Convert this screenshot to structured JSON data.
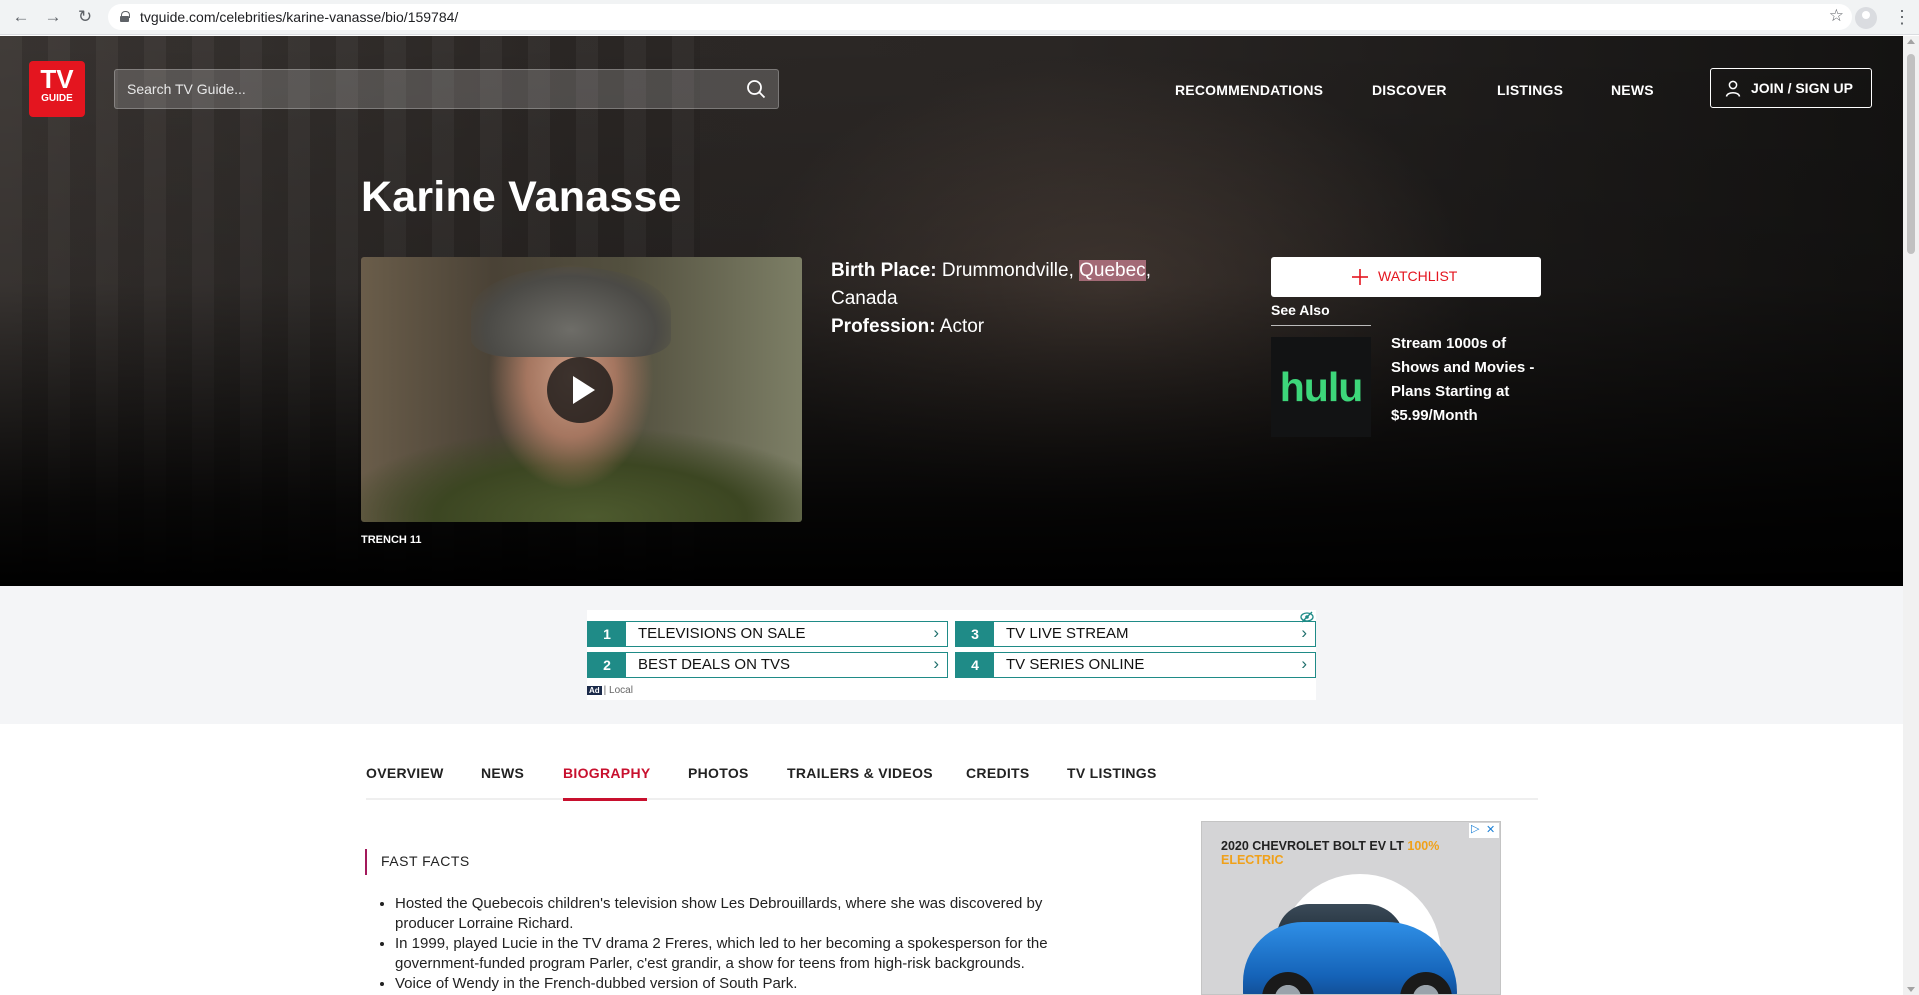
{
  "browser": {
    "url": "tvguide.com/celebrities/karine-vanasse/bio/159784/",
    "back_icon": "arrow-left-icon",
    "forward_icon": "arrow-right-icon",
    "reload_icon": "reload-icon"
  },
  "header": {
    "logo_top": "TV",
    "logo_bottom": "GUIDE",
    "search_placeholder": "Search TV Guide...",
    "nav": [
      "RECOMMENDATIONS",
      "DISCOVER",
      "LISTINGS",
      "NEWS"
    ],
    "join_label": "JOIN / SIGN UP"
  },
  "hero": {
    "name": "Karine Vanasse",
    "video_caption": "TRENCH 11",
    "birth_place_label": "Birth Place:",
    "birth_place_city": "Drummondville,",
    "birth_place_region": "Quebec",
    "birth_place_sep": ",",
    "birth_place_country": "Canada",
    "profession_label": "Profession:",
    "profession_value": "Actor",
    "watchlist_label": "WATCHLIST",
    "see_also_heading": "See Also",
    "see_also_logo": "hulu",
    "see_also_text": "Stream 1000s of Shows and Movies - Plans Starting at $5.99/Month"
  },
  "ad_links": [
    {
      "num": "1",
      "text": "TELEVISIONS ON SALE"
    },
    {
      "num": "3",
      "text": "TV LIVE STREAM"
    },
    {
      "num": "2",
      "text": "BEST DEALS ON TVS"
    },
    {
      "num": "4",
      "text": "TV SERIES ONLINE"
    }
  ],
  "ad_badge": "Ad",
  "ad_local": "| Local",
  "tabs": [
    "OVERVIEW",
    "NEWS",
    "BIOGRAPHY",
    "PHOTOS",
    "TRAILERS & VIDEOS",
    "CREDITS",
    "TV LISTINGS"
  ],
  "active_tab": "BIOGRAPHY",
  "fast_facts": {
    "title": "FAST FACTS",
    "items": [
      "Hosted the Quebecois children's television show Les Debrouillards, where she was discovered by producer Lorraine Richard.",
      "In 1999, played Lucie in the TV drama 2 Freres, which led to her becoming a spokesperson for the government-funded program Parler, c'est grandir, a show for teens from high-risk backgrounds.",
      "Voice of Wendy in the French-dubbed version of South Park."
    ]
  },
  "side_ad": {
    "title_main": "2020 CHEVROLET BOLT EV LT",
    "title_accent": "100% ELECTRIC"
  },
  "colors": {
    "brand_red": "#e4151f",
    "active_tab": "#c8102e",
    "ad_teal": "#1f8b87",
    "hulu_green": "#3dd67a"
  }
}
